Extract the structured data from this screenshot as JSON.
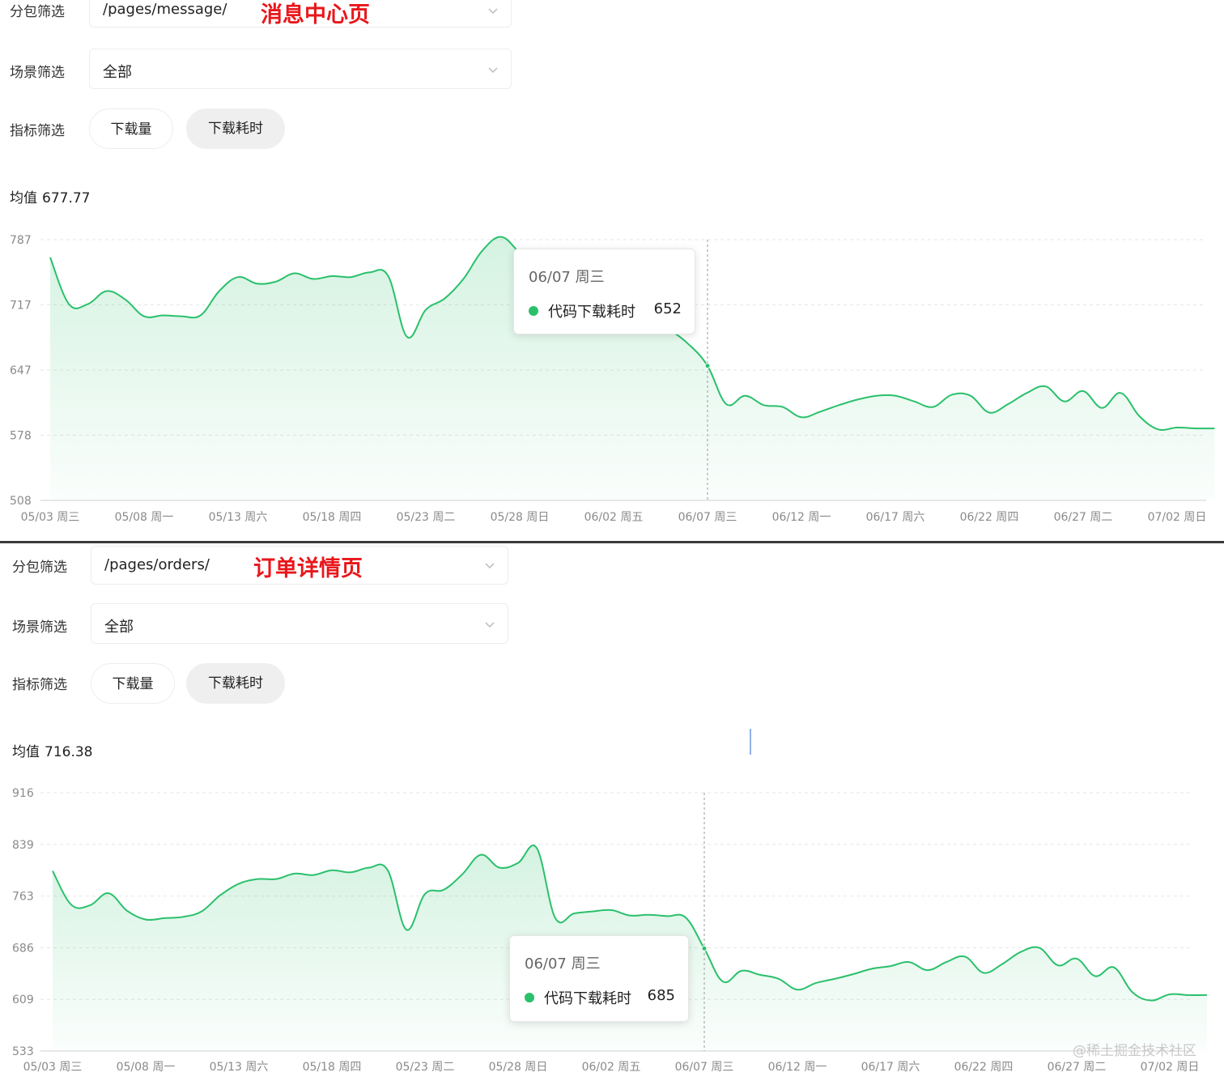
{
  "panels": [
    {
      "filters": {
        "package_label": "分包筛选",
        "package_value": "/pages/message/",
        "scene_label": "场景筛选",
        "scene_value": "全部",
        "metric_label": "指标筛选",
        "metric_options": [
          "下载量",
          "下载耗时"
        ],
        "metric_selected": "下载耗时"
      },
      "annotation": "消息中心页",
      "mean_label": "均值",
      "mean_value": "677.77",
      "tooltip": {
        "date": "06/07 周三",
        "series": "代码下载耗时",
        "value": "652"
      }
    },
    {
      "filters": {
        "package_label": "分包筛选",
        "package_value": "/pages/orders/",
        "scene_label": "场景筛选",
        "scene_value": "全部",
        "metric_label": "指标筛选",
        "metric_options": [
          "下载量",
          "下载耗时"
        ],
        "metric_selected": "下载耗时"
      },
      "annotation": "订单详情页",
      "mean_label": "均值",
      "mean_value": "716.38",
      "tooltip": {
        "date": "06/07 周三",
        "series": "代码下载耗时",
        "value": "685"
      }
    }
  ],
  "watermark": "@稀土掘金技术社区",
  "chart_data": [
    {
      "type": "area",
      "series_name": "代码下载耗时",
      "color": "#2ac06b",
      "ylim": [
        508,
        787
      ],
      "yticks": [
        "787",
        "717",
        "647",
        "578",
        "508"
      ],
      "xticks": [
        "05/03 周三",
        "05/08 周一",
        "05/13 周六",
        "05/18 周四",
        "05/23 周二",
        "05/28 周日",
        "06/02 周五",
        "06/07 周三",
        "06/12 周一",
        "06/17 周六",
        "06/22 周四",
        "06/27 周二",
        "07/02 周日"
      ],
      "x": [
        "05/03",
        "05/04",
        "05/05",
        "05/06",
        "05/07",
        "05/08",
        "05/09",
        "05/10",
        "05/11",
        "05/12",
        "05/13",
        "05/14",
        "05/15",
        "05/16",
        "05/17",
        "05/18",
        "05/19",
        "05/20",
        "05/21",
        "05/22",
        "05/23",
        "05/24",
        "05/25",
        "05/26",
        "05/27",
        "05/28",
        "05/29",
        "05/30",
        "05/31",
        "06/01",
        "06/02",
        "06/03",
        "06/04",
        "06/05",
        "06/06",
        "06/07",
        "06/08",
        "06/09",
        "06/10",
        "06/11",
        "06/12",
        "06/13",
        "06/14",
        "06/15",
        "06/16",
        "06/17",
        "06/18",
        "06/19",
        "06/20",
        "06/21",
        "06/22",
        "06/23",
        "06/24",
        "06/25",
        "06/26",
        "06/27",
        "06/28",
        "06/29",
        "06/30",
        "07/01",
        "07/02",
        "07/03",
        "07/04"
      ],
      "values": [
        768,
        718,
        718,
        732,
        723,
        705,
        706,
        705,
        706,
        732,
        747,
        740,
        742,
        751,
        745,
        748,
        747,
        752,
        748,
        683,
        712,
        724,
        745,
        775,
        790,
        773,
        755,
        748,
        745,
        739,
        725,
        715,
        698,
        690,
        675,
        652,
        611,
        620,
        610,
        608,
        597,
        603,
        610,
        616,
        620,
        620,
        614,
        608,
        621,
        620,
        602,
        611,
        623,
        630,
        614,
        625,
        607,
        623,
        598,
        584,
        586,
        585,
        585
      ],
      "highlight_index": 35
    },
    {
      "type": "area",
      "series_name": "代码下载耗时",
      "color": "#2ac06b",
      "ylim": [
        533,
        916
      ],
      "yticks": [
        "916",
        "839",
        "763",
        "686",
        "609",
        "533"
      ],
      "xticks": [
        "05/03 周三",
        "05/08 周一",
        "05/13 周六",
        "05/18 周四",
        "05/23 周二",
        "05/28 周日",
        "06/02 周五",
        "06/07 周三",
        "06/12 周一",
        "06/17 周六",
        "06/22 周四",
        "06/27 周二",
        "07/02 周日"
      ],
      "x": [
        "05/03",
        "05/04",
        "05/05",
        "05/06",
        "05/07",
        "05/08",
        "05/09",
        "05/10",
        "05/11",
        "05/12",
        "05/13",
        "05/14",
        "05/15",
        "05/16",
        "05/17",
        "05/18",
        "05/19",
        "05/20",
        "05/21",
        "05/22",
        "05/23",
        "05/24",
        "05/25",
        "05/26",
        "05/27",
        "05/28",
        "05/29",
        "05/30",
        "05/31",
        "06/01",
        "06/02",
        "06/03",
        "06/04",
        "06/05",
        "06/06",
        "06/07",
        "06/08",
        "06/09",
        "06/10",
        "06/11",
        "06/12",
        "06/13",
        "06/14",
        "06/15",
        "06/16",
        "06/17",
        "06/18",
        "06/19",
        "06/20",
        "06/21",
        "06/22",
        "06/23",
        "06/24",
        "06/25",
        "06/26",
        "06/27",
        "06/28",
        "06/29",
        "06/30",
        "07/01",
        "07/02",
        "07/03",
        "07/04"
      ],
      "values": [
        800,
        750,
        749,
        767,
        741,
        728,
        730,
        732,
        740,
        764,
        781,
        788,
        788,
        796,
        794,
        801,
        798,
        805,
        801,
        713,
        766,
        772,
        795,
        824,
        805,
        812,
        834,
        730,
        737,
        740,
        742,
        734,
        735,
        733,
        731,
        685,
        636,
        652,
        646,
        640,
        624,
        634,
        640,
        647,
        655,
        659,
        665,
        653,
        665,
        673,
        649,
        662,
        680,
        686,
        660,
        670,
        644,
        657,
        620,
        608,
        617,
        616,
        616
      ],
      "highlight_index": 35
    }
  ]
}
